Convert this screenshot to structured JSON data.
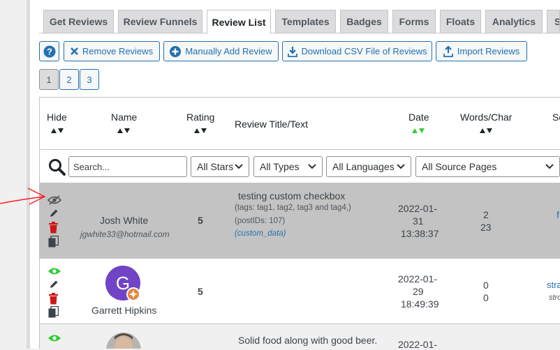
{
  "tabs": [
    {
      "label": "Get Reviews"
    },
    {
      "label": "Review Funnels"
    },
    {
      "label": "Review List",
      "active": true
    },
    {
      "label": "Templates"
    },
    {
      "label": "Badges"
    },
    {
      "label": "Forms"
    },
    {
      "label": "Floats"
    },
    {
      "label": "Analytics"
    },
    {
      "label": "S"
    }
  ],
  "toolbar": {
    "help_label": "?",
    "remove_label": "Remove Reviews",
    "add_label": "Manually Add Review",
    "download_label": "Download CSV File of Reviews",
    "import_label": "Import Reviews"
  },
  "pagination": [
    "1",
    "2",
    "3"
  ],
  "columns": {
    "hide": "Hide",
    "name": "Name",
    "rating": "Rating",
    "title": "Review Title/Text",
    "date": "Date",
    "words": "Words/Char",
    "source": "So"
  },
  "filters": {
    "search_placeholder": "Search...",
    "stars": "All Stars",
    "types": "All Types",
    "languages": "All Languages",
    "pages": "All Source Pages"
  },
  "rows": [
    {
      "name": "Josh White",
      "email": "jgwhite33@hotmail.com",
      "rating": "5",
      "title": "testing custom checkbox",
      "tags": "(tags: tag1, tag2, tag3 and tag4,)",
      "postids": "(postIDs: 107)",
      "custom": "(custom_data)",
      "date1": "2022-01-",
      "date2": "31",
      "time": "13:38:37",
      "words": "2",
      "chars": "23",
      "source": "f",
      "hidden": true
    },
    {
      "name": "Garrett Hipkins",
      "avatar_letter": "G",
      "rating": "5",
      "date1": "2022-01-",
      "date2": "29",
      "time": "18:49:39",
      "words": "0",
      "chars": "0",
      "source1": "stra",
      "source2": "stro"
    },
    {
      "title": "Solid food along with good beer.",
      "date1": "2022-01-"
    }
  ],
  "colors": {
    "accent": "#2271b1",
    "hidden_row": "#c3c3c3",
    "eye_visible": "#33cc33",
    "trash": "#cc1818",
    "sort_active": "#33cc33",
    "annotation_arrow": "#ff1a1a",
    "avatar": "#7044c4"
  }
}
